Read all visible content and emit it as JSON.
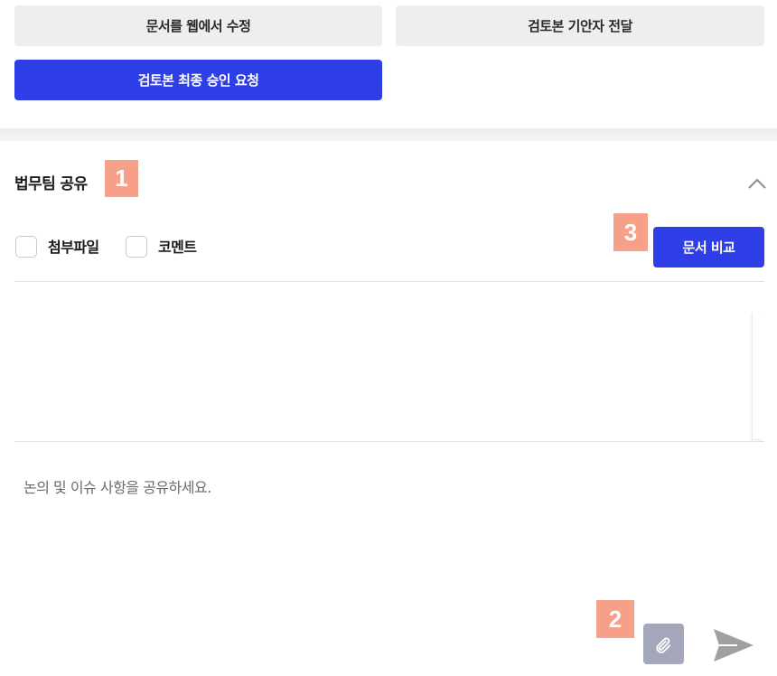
{
  "actions": {
    "edit_on_web": "문서를 웹에서 수정",
    "send_to_drafter": "검토본 기안자 전달",
    "request_final_approval": "검토본 최종 승인 요청"
  },
  "legal_share": {
    "title": "법무팀 공유",
    "filters": {
      "attachments_label": "첨부파일",
      "comments_label": "코멘트"
    },
    "compare_button": "문서 비교",
    "comment_placeholder": "논의 및 이슈 사항을 공유하세요."
  },
  "annotations": [
    "1",
    "2",
    "3"
  ],
  "colors": {
    "primary": "#2f3fe8",
    "button_gray": "#eeeeee",
    "badge": "#f6a08a",
    "attach": "#a4a6ba"
  }
}
